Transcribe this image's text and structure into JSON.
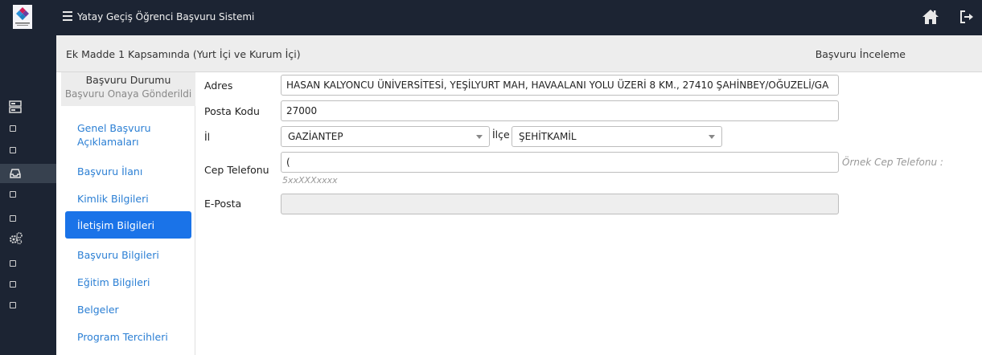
{
  "app": {
    "title": "Yatay Geçiş Öğrenci Başvuru Sistemi"
  },
  "header": {
    "left": "Ek Madde 1 Kapsamında (Yurt İçi ve Kurum İçi)",
    "right": "Başvuru İnceleme"
  },
  "status": {
    "title": "Başvuru Durumu",
    "value": "Başvuru Onaya Gönderildi"
  },
  "nav": [
    {
      "label": "Genel Başvuru Açıklamaları"
    },
    {
      "label": "Başvuru İlanı"
    },
    {
      "label": "Kimlik Bilgileri"
    },
    {
      "label": "İletişim Bilgileri"
    },
    {
      "label": "Başvuru Bilgileri"
    },
    {
      "label": "Eğitim Bilgileri"
    },
    {
      "label": "Belgeler"
    },
    {
      "label": "Program Tercihleri"
    }
  ],
  "form": {
    "adres": {
      "label": "Adres",
      "value": "HASAN KALYONCU ÜNİVERSİTESİ, YEŞİLYURT MAH, HAVAALANI YOLU ÜZERİ 8 KM., 27410 ŞAHİNBEY/OĞUZELİ/GA"
    },
    "posta": {
      "label": "Posta Kodu",
      "value": "27000"
    },
    "il": {
      "label": "İl",
      "value": "GAZİANTEP"
    },
    "ilce": {
      "label": "İlçe",
      "value": "ŞEHİTKAMİL"
    },
    "cep": {
      "label": "Cep Telefonu",
      "value": "(",
      "hint": "Örnek Cep Telefonu :",
      "hint2": "5xxXXXxxxx"
    },
    "eposta": {
      "label": "E-Posta",
      "value": ""
    }
  },
  "colors": {
    "topbar": "#1c2433",
    "accent": "#1a73e8",
    "link": "#2b7fd4"
  },
  "icons": {
    "menu": "hamburger-icon",
    "home": "home-icon",
    "logout": "logout-icon"
  }
}
